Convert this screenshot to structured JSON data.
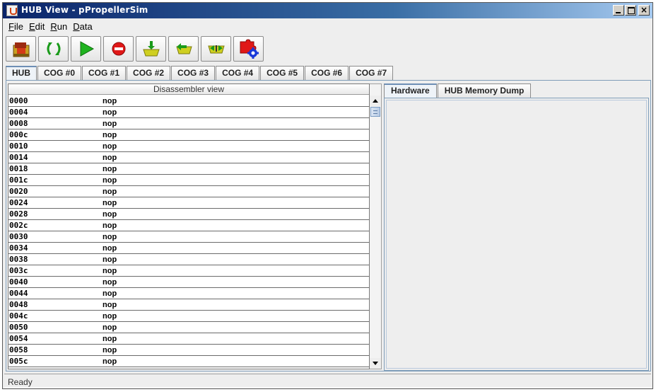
{
  "window": {
    "title": "HUB View - pPropellerSim"
  },
  "menu": [
    {
      "mnemonic": "F",
      "rest": "ile"
    },
    {
      "mnemonic": "E",
      "rest": "dit"
    },
    {
      "mnemonic": "R",
      "rest": "un"
    },
    {
      "mnemonic": "D",
      "rest": "ata"
    }
  ],
  "toolbar": {
    "icons": [
      "load-icon",
      "step-icon",
      "run-icon",
      "stop-icon",
      "download-icon",
      "step-back-icon",
      "transfer-icon",
      "settings-puzzle-icon"
    ]
  },
  "main_tabs": [
    "HUB",
    "COG #0",
    "COG #1",
    "COG #2",
    "COG #3",
    "COG #4",
    "COG #5",
    "COG #6",
    "COG #7"
  ],
  "disassembler": {
    "header": "Disassembler view",
    "rows": [
      {
        "addr": "0000",
        "op": "nop"
      },
      {
        "addr": "0004",
        "op": "nop"
      },
      {
        "addr": "0008",
        "op": "nop"
      },
      {
        "addr": "000c",
        "op": "nop"
      },
      {
        "addr": "0010",
        "op": "nop"
      },
      {
        "addr": "0014",
        "op": "nop"
      },
      {
        "addr": "0018",
        "op": "nop"
      },
      {
        "addr": "001c",
        "op": "nop"
      },
      {
        "addr": "0020",
        "op": "nop"
      },
      {
        "addr": "0024",
        "op": "nop"
      },
      {
        "addr": "0028",
        "op": "nop"
      },
      {
        "addr": "002c",
        "op": "nop"
      },
      {
        "addr": "0030",
        "op": "nop"
      },
      {
        "addr": "0034",
        "op": "nop"
      },
      {
        "addr": "0038",
        "op": "nop"
      },
      {
        "addr": "003c",
        "op": "nop"
      },
      {
        "addr": "0040",
        "op": "nop"
      },
      {
        "addr": "0044",
        "op": "nop"
      },
      {
        "addr": "0048",
        "op": "nop"
      },
      {
        "addr": "004c",
        "op": "nop"
      },
      {
        "addr": "0050",
        "op": "nop"
      },
      {
        "addr": "0054",
        "op": "nop"
      },
      {
        "addr": "0058",
        "op": "nop"
      },
      {
        "addr": "005c",
        "op": "nop"
      }
    ]
  },
  "sub_tabs": [
    "Hardware",
    "HUB Memory Dump"
  ],
  "status": {
    "text": "Ready"
  }
}
